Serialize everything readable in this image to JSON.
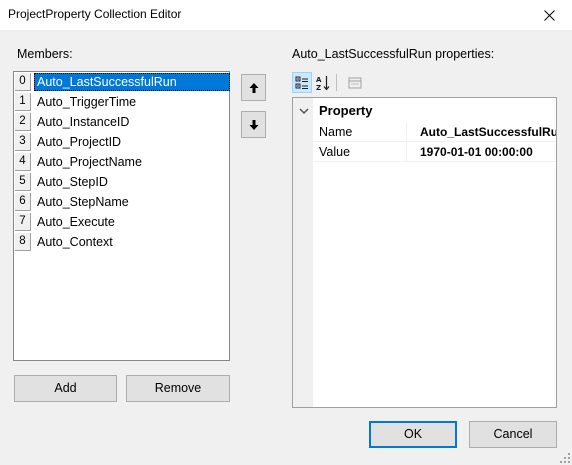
{
  "window": {
    "title": "ProjectProperty Collection Editor",
    "close_icon": "close-icon"
  },
  "members": {
    "label": "Members:",
    "items": [
      {
        "index": "0",
        "name": "Auto_LastSuccessfulRun",
        "selected": true
      },
      {
        "index": "1",
        "name": "Auto_TriggerTime"
      },
      {
        "index": "2",
        "name": "Auto_InstanceID"
      },
      {
        "index": "3",
        "name": "Auto_ProjectID"
      },
      {
        "index": "4",
        "name": "Auto_ProjectName"
      },
      {
        "index": "5",
        "name": "Auto_StepID"
      },
      {
        "index": "6",
        "name": "Auto_StepName"
      },
      {
        "index": "7",
        "name": "Auto_Execute"
      },
      {
        "index": "8",
        "name": "Auto_Context"
      }
    ],
    "add_label": "Add",
    "remove_label": "Remove"
  },
  "properties": {
    "label": "Auto_LastSuccessfulRun properties:",
    "category": "Property",
    "rows": [
      {
        "name": "Name",
        "value": "Auto_LastSuccessfulRun"
      },
      {
        "name": "Value",
        "value": "1970-01-01 00:00:00"
      }
    ]
  },
  "dialog": {
    "ok_label": "OK",
    "cancel_label": "Cancel"
  },
  "colors": {
    "selection": "#0078d7",
    "accent_border": "#0078d7"
  }
}
